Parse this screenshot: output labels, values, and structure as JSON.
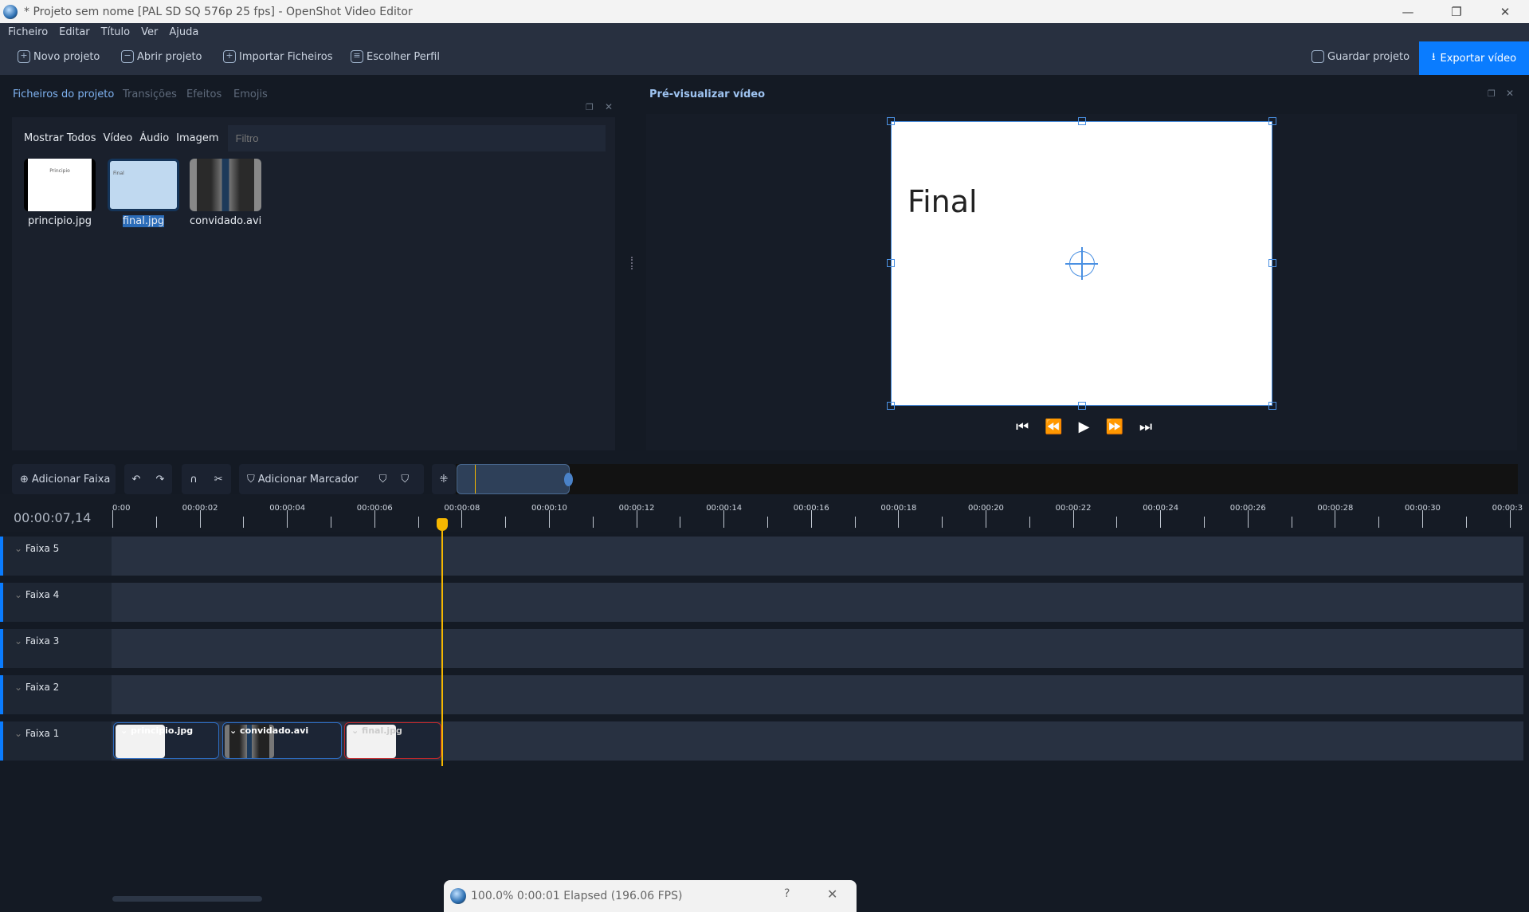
{
  "window": {
    "title": "* Projeto sem nome [PAL SD SQ 576p 25 fps] - OpenShot Video Editor"
  },
  "menu": [
    "Ficheiro",
    "Editar",
    "Título",
    "Ver",
    "Ajuda"
  ],
  "toolbar": {
    "new": "Novo projeto",
    "open": "Abrir projeto",
    "import": "Importar Ficheiros",
    "profile": "Escolher Perfil",
    "save": "Guardar projeto",
    "export": "Exportar vídeo"
  },
  "left_panel": {
    "tabs": [
      "Ficheiros do projeto",
      "Transições",
      "Efeitos",
      "Emojis"
    ],
    "filters": [
      "Mostrar Todos",
      "Vídeo",
      "Áudio",
      "Imagem"
    ],
    "filter_placeholder": "Filtro",
    "files": [
      {
        "name": "principio.jpg",
        "caption": "Principio"
      },
      {
        "name": "final.jpg",
        "caption": "Final",
        "selected": true
      },
      {
        "name": "convidado.avi"
      }
    ]
  },
  "preview": {
    "title": "Pré-visualizar vídeo",
    "frame_text": "Final"
  },
  "timeline": {
    "add_track": "Adicionar Faixa",
    "add_marker": "Adicionar Marcador",
    "current_time": "00:00:07,14",
    "ruler_labels": [
      "0:00",
      "00:00:02",
      "00:00:04",
      "00:00:06",
      "00:00:08",
      "00:00:10",
      "00:00:12",
      "00:00:14",
      "00:00:16",
      "00:00:18",
      "00:00:20",
      "00:00:22",
      "00:00:24",
      "00:00:26",
      "00:00:28",
      "00:00:30",
      "00:00:3"
    ],
    "playhead_seconds": 7.56,
    "tracks": [
      "Faixa 5",
      "Faixa 4",
      "Faixa 3",
      "Faixa 2",
      "Faixa 1"
    ],
    "clips": [
      {
        "name": "principio.jpg"
      },
      {
        "name": "convidado.avi"
      },
      {
        "name": "final.jpg"
      }
    ]
  },
  "progress": {
    "text": "100.0%  0:00:01 Elapsed (196.06 FPS)",
    "help": "?"
  },
  "colors": {
    "accent": "#0a7cff",
    "playhead": "#f5b700"
  }
}
